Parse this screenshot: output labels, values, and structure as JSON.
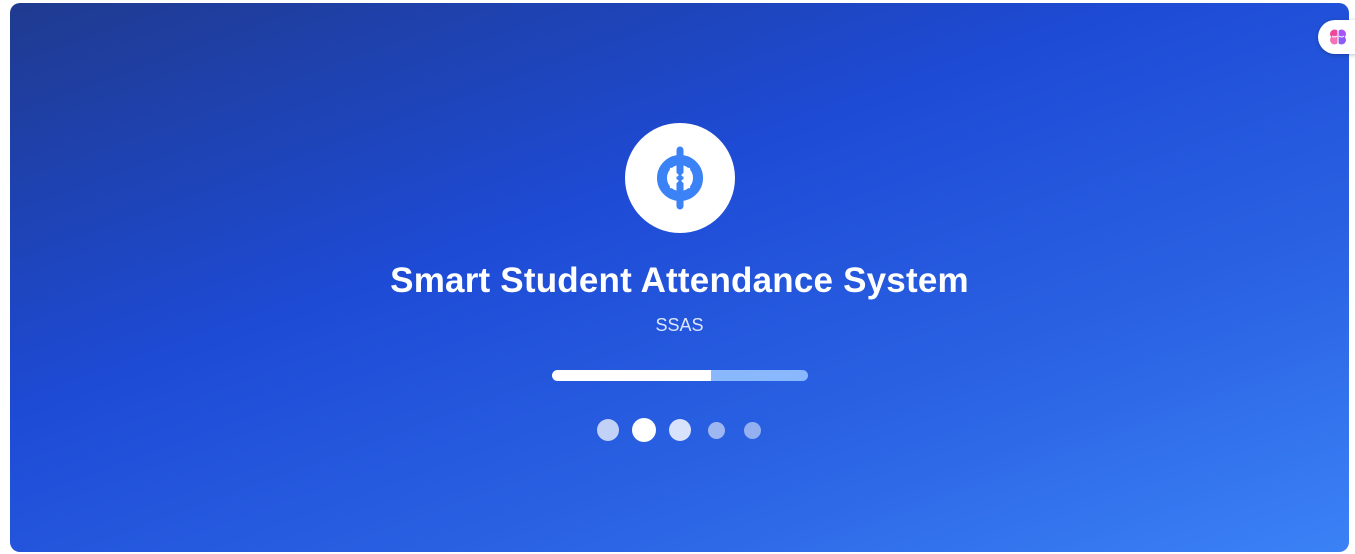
{
  "splash": {
    "title": "Smart Student Attendance System",
    "subtitle": "SSAS",
    "logo_icon": "ship-wheel-icon",
    "progress": 0.62,
    "dots": {
      "count": 5,
      "active_index": 1
    }
  },
  "extension_tab": {
    "icon": "brain-icon"
  },
  "colors": {
    "background_start": "#1f3a8f",
    "background_mid": "#1e4bd6",
    "background_end": "#3b82f6",
    "logo_blue": "#3b82f6",
    "progress_track": "#8ab8ff",
    "progress_fill": "#ffffff"
  }
}
